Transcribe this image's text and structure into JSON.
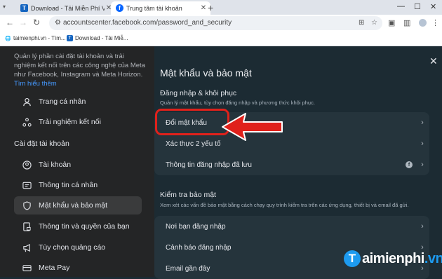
{
  "browser": {
    "tabs": [
      {
        "favicon": "T",
        "title": "Download - Tải Miễn Phí VN - Ph",
        "active": false
      },
      {
        "favicon": "f",
        "title": "Trung tâm tài khoản",
        "active": true
      }
    ],
    "new_tab": "+",
    "url": "accountscenter.facebook.com/password_and_security",
    "bookmarks": [
      {
        "label": "taimienphi.vn - Tìm..."
      },
      {
        "label": "Download - Tải Miễ..."
      }
    ]
  },
  "sidebar": {
    "intro_text": "Quản lý phần cài đặt tài khoản và trải nghiệm kết nối trên các công nghệ của Meta như Facebook, Instagram và Meta Horizon.",
    "intro_link": "Tìm hiểu thêm",
    "top_items": [
      {
        "label": "Trang cá nhân",
        "icon": "profile-icon"
      },
      {
        "label": "Trải nghiệm kết nối",
        "icon": "connected-experiences-icon"
      }
    ],
    "settings_heading": "Cài đặt tài khoản",
    "items": [
      {
        "label": "Tài khoản",
        "icon": "account-icon",
        "active": false
      },
      {
        "label": "Thông tin cá nhân",
        "icon": "id-card-icon",
        "active": false
      },
      {
        "label": "Mật khẩu và bảo mật",
        "icon": "shield-icon",
        "active": true
      },
      {
        "label": "Thông tin và quyền của bạn",
        "icon": "document-lock-icon",
        "active": false
      },
      {
        "label": "Tùy chọn quảng cáo",
        "icon": "megaphone-icon",
        "active": false
      },
      {
        "label": "Meta Pay",
        "icon": "card-icon",
        "active": false
      }
    ]
  },
  "main": {
    "title": "Mật khẩu và bảo mật",
    "login_section": {
      "title": "Đăng nhập & khôi phục",
      "desc": "Quản lý mật khẩu, tùy chọn đăng nhập và phương thức khôi phục.",
      "rows": [
        {
          "label": "Đổi mật khẩu"
        },
        {
          "label": "Xác thực 2 yếu tố"
        },
        {
          "label": "Thông tin đăng nhập đã lưu"
        }
      ]
    },
    "security_section": {
      "title": "Kiểm tra bảo mật",
      "desc": "Xem xét các vấn đề bảo mật bằng cách chạy quy trình kiểm tra trên các ứng dụng, thiết bị và email đã gửi.",
      "rows": [
        {
          "label": "Nơi bạn đăng nhập"
        },
        {
          "label": "Cảnh báo đăng nhập"
        },
        {
          "label": "Email gần đây"
        }
      ]
    }
  },
  "watermark": {
    "letter": "T",
    "text": "aimienphi",
    "suffix": ".vn"
  },
  "colors": {
    "highlight": "#e0211b",
    "background": "#1c2b33",
    "sidebar": "#242526"
  }
}
